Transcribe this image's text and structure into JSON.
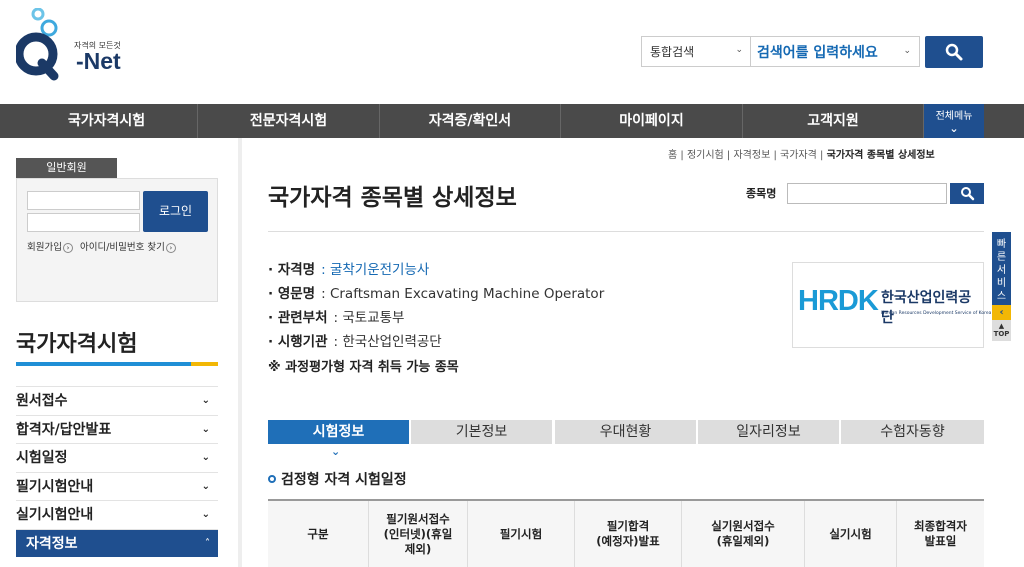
{
  "logo": {
    "tagline": "자격의 모든것",
    "name": "-Net"
  },
  "search": {
    "scope": "통합검색",
    "placeholder": "검색어를 입력하세요"
  },
  "gnb": {
    "items": [
      "국가자격시험",
      "전문자격시험",
      "자격증/확인서",
      "마이페이지",
      "고객지원"
    ],
    "all_menu": "전체메뉴"
  },
  "login": {
    "tab": "일반회원",
    "button": "로그인",
    "join": "회원가입",
    "find": "아이디/비밀번호 찾기"
  },
  "sidebar": {
    "title": "국가자격시험",
    "menu": [
      "원서접수",
      "합격자/답안발표",
      "시험일정",
      "필기시험안내",
      "실기시험안내",
      "자격정보"
    ]
  },
  "breadcrumb": {
    "items": [
      "홈",
      "정기시험",
      "자격정보",
      "국가자격"
    ],
    "current": "국가자격 종목별 상세정보"
  },
  "page": {
    "title": "국가자격 종목별 상세정보",
    "search_label": "종목명"
  },
  "info": {
    "name_label": "자격명",
    "name": ": 굴착기운전기능사",
    "eng_label": "영문명",
    "eng": ": Craftsman Excavating Machine Operator",
    "dept_label": "관련부처",
    "dept": ": 국토교통부",
    "org_label": "시행기관",
    "org": ": 한국산업인력공단",
    "note": "※ 과정평가형 자격 취득 가능 종목"
  },
  "org_logo": {
    "mark": "HRDK",
    "name": "한국산업인력공단",
    "eng": "Human Resources Development Service of Korea"
  },
  "quick": {
    "label": "빠른서비스",
    "top": "TOP"
  },
  "tabs": [
    "시험정보",
    "기본정보",
    "우대현황",
    "일자리정보",
    "수험자동향"
  ],
  "section": {
    "title": "검정형 자격 시험일정"
  },
  "table": {
    "headers": [
      "구분",
      "필기원서접수\n(인터넷)(휴일\n제외)",
      "필기시험",
      "필기합격\n(예정자)발표",
      "실기원서접수\n(휴일제외)",
      "실기시험",
      "최종합격자\n발표일"
    ]
  },
  "colors": {
    "primary": "#1f4f8f",
    "accent": "#1f8fd6",
    "yellow": "#f2b705",
    "gnb": "#4a4a4a"
  }
}
